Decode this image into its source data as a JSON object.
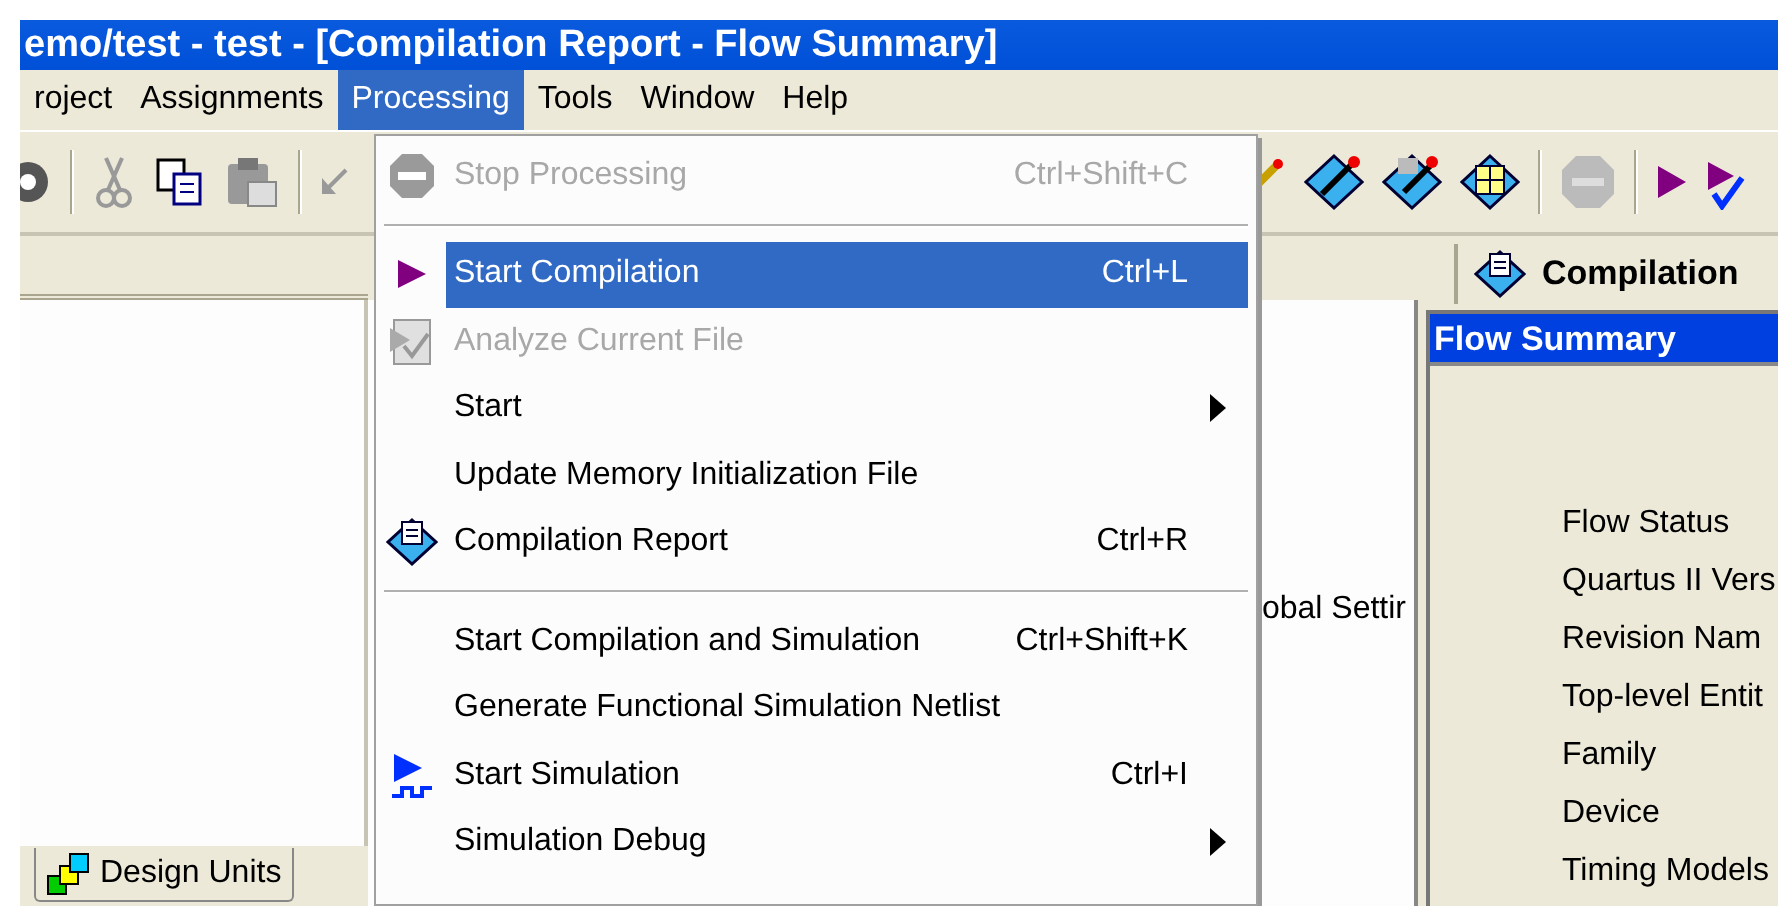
{
  "window": {
    "title": "emo/test - test - [Compilation Report - Flow Summary]"
  },
  "menu_bar": [
    {
      "label": "roject",
      "selected": false
    },
    {
      "label": "Assignments",
      "selected": false
    },
    {
      "label": "Processing",
      "selected": true
    },
    {
      "label": "Tools",
      "selected": false
    },
    {
      "label": "Window",
      "selected": false
    },
    {
      "label": "Help",
      "selected": false
    }
  ],
  "left_panel": {
    "tab": {
      "label": "Design Units",
      "selected": true
    }
  },
  "middle_panel": {
    "text": "obal Settir"
  },
  "report_tab": {
    "label": "Compilation"
  },
  "flow_summary": {
    "title": "Flow Summary",
    "rows": [
      "Flow Status",
      "Quartus II Vers",
      "Revision Nam",
      "Top-level Entit",
      "Family",
      "Device",
      "Timing Models"
    ]
  },
  "menu": {
    "items": [
      {
        "kind": "item",
        "label": "Stop Processing",
        "shortcut": "Ctrl+Shift+C",
        "disabled": true,
        "selected": false,
        "submenu": false
      },
      {
        "kind": "separator"
      },
      {
        "kind": "item",
        "label": "Start Compilation",
        "shortcut": "Ctrl+L",
        "disabled": false,
        "selected": true,
        "submenu": false
      },
      {
        "kind": "item",
        "label": "Analyze Current File",
        "disabled": true,
        "selected": false,
        "submenu": false
      },
      {
        "kind": "item",
        "label": "Start",
        "disabled": false,
        "selected": false,
        "submenu": true
      },
      {
        "kind": "item",
        "label": "Update Memory Initialization File",
        "disabled": false,
        "selected": false,
        "submenu": false
      },
      {
        "kind": "item",
        "label": "Compilation Report",
        "shortcut": "Ctrl+R",
        "disabled": false,
        "selected": false,
        "submenu": false
      },
      {
        "kind": "separator"
      },
      {
        "kind": "item",
        "label": "Start Compilation and Simulation",
        "shortcut": "Ctrl+Shift+K",
        "disabled": false,
        "selected": false,
        "submenu": false
      },
      {
        "kind": "item",
        "label": "Generate Functional Simulation Netlist",
        "disabled": false,
        "selected": false,
        "submenu": false
      },
      {
        "kind": "item",
        "label": "Start Simulation",
        "shortcut": "Ctrl+I",
        "disabled": false,
        "selected": false,
        "submenu": false
      },
      {
        "kind": "item",
        "label": "Simulation Debug",
        "disabled": false,
        "selected": false,
        "submenu": true
      }
    ]
  }
}
